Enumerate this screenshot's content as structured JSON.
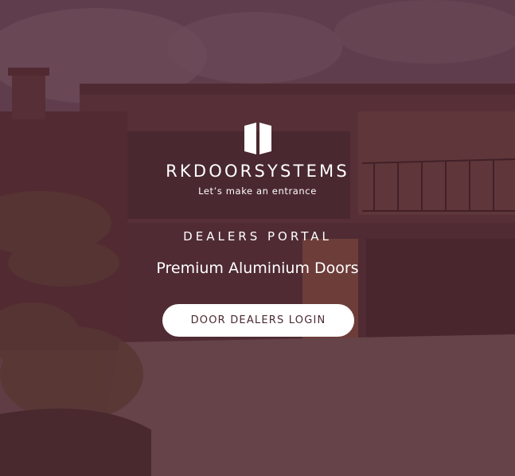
{
  "brand": {
    "name": "RKDOORSYSTEMS",
    "tagline": "Let’s make an entrance",
    "logo_icon": "double-door-logo-icon"
  },
  "hero": {
    "portal_title": "DEALERS PORTAL",
    "subtitle": "Premium Aluminium Doors",
    "login_button_label": "DOOR DEALERS LOGIN"
  },
  "colors": {
    "overlay": "#562632",
    "text": "#ffffff",
    "button_bg": "#ffffff",
    "button_text": "#4a2a30"
  }
}
